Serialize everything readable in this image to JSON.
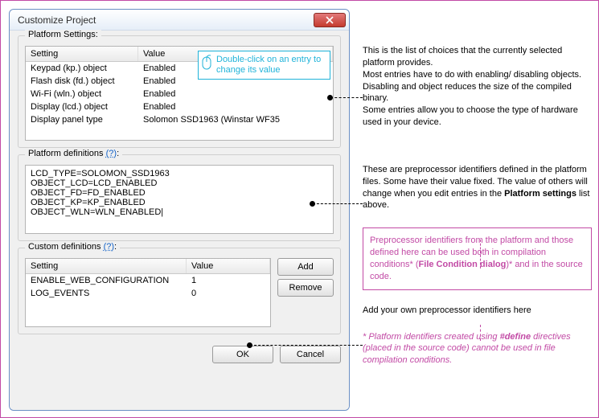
{
  "dialog": {
    "title": "Customize Project",
    "platform_settings": {
      "label": "Platform Settings:",
      "headers": {
        "setting": "Setting",
        "value": "Value"
      },
      "rows": [
        {
          "setting": "Keypad (kp.) object",
          "value": "Enabled"
        },
        {
          "setting": "Flash disk (fd.) object",
          "value": "Enabled"
        },
        {
          "setting": "Wi-Fi (wln.) object",
          "value": "Enabled"
        },
        {
          "setting": "Display (lcd.) object",
          "value": "Enabled"
        },
        {
          "setting": "Display panel type",
          "value": "Solomon SSD1963 (Winstar WF35"
        }
      ]
    },
    "platform_definitions": {
      "label": "Platform definitions",
      "help": "(?)",
      "text": "LCD_TYPE=SOLOMON_SSD1963\nOBJECT_LCD=LCD_ENABLED\nOBJECT_FD=FD_ENABLED\nOBJECT_KP=KP_ENABLED\nOBJECT_WLN=WLN_ENABLED|"
    },
    "custom_definitions": {
      "label": "Custom definitions",
      "help": "(?)",
      "headers": {
        "setting": "Setting",
        "value": "Value"
      },
      "rows": [
        {
          "setting": "ENABLE_WEB_CONFIGURATION",
          "value": "1"
        },
        {
          "setting": "LOG_EVENTS",
          "value": "0"
        }
      ],
      "add": "Add",
      "remove": "Remove"
    },
    "buttons": {
      "ok": "OK",
      "cancel": "Cancel"
    }
  },
  "hint": {
    "text": "Double-click on an entry to change its value"
  },
  "annotations": {
    "settings_desc": "This is the list of choices that the currently selected platform provides.\nMost entries have to do with enabling/ disabling objects. Disabling and object reduces the size of the compiled binary.\nSome entries allow you to choose the type of hardware used in your device.",
    "defs_desc_pre": "These are preprocessor identifiers defined in the platform files. Some have their value fixed. The value of others will change when you edit entries in the ",
    "defs_desc_bold": "Platform settings",
    "defs_desc_post": " list above.",
    "box_pre": "Preprocessor identifiers from the platform and those defined here can be used both in compilation conditions* (",
    "box_bold": "File Condition dialog",
    "box_post": ")* and in the source code.",
    "custom_desc": "Add your own preprocessor identifiers here",
    "footnote_pre": "* Platform identifiers created using ",
    "footnote_bold": "#define",
    "footnote_post": " directives (placed in the source code) cannot be used in file compilation conditions."
  }
}
